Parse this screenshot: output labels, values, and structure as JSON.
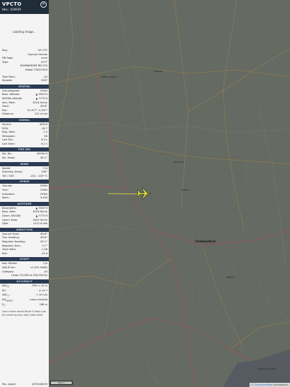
{
  "header": {
    "registration": "VPCTO",
    "hex": "Hex.: 424919",
    "close_icon": "close-icon"
  },
  "image": {
    "loading": "Loading image..."
  },
  "info": [
    {
      "k": "Reg.:",
      "v": "VP-CTO"
    },
    {
      "k": "",
      "v": "Cayman Islands"
    },
    {
      "k": "DB flags:",
      "v": "none"
    },
    {
      "k": "Type:",
      "v": "GL7T"
    },
    {
      "k": "",
      "v": "BOMBARDIER BD-700"
    },
    {
      "k": "",
      "v": "Global 7500/7500"
    }
  ],
  "info2": [
    {
      "k": "Type Desc.:",
      "v": "L2J"
    },
    {
      "k": "Squawk:",
      "v": "5267"
    }
  ],
  "sections": [
    {
      "title": "SPATIAL",
      "rows": [
        {
          "k": "Groundspeed:",
          "v": "293kt"
        },
        {
          "k": "Baro. Altitude:",
          "v": "▲ 7625 ft"
        },
        {
          "k": "WGS84 altitude:",
          "v": "▲ 7775 ft"
        },
        {
          "k": "Vert. Rate:",
          "v": "3024 ft/min"
        },
        {
          "k": "Track:",
          "v": "85.8°"
        },
        {
          "k": "Pos.:",
          "v": "51.917°, 0.337°"
        },
        {
          "k": "Distance:",
          "v": "221.4 nmi"
        }
      ]
    },
    {
      "title": "SIGNAL",
      "rows": [
        {
          "k": "Source:",
          "v": "ADS-B"
        },
        {
          "k": "RSSI:",
          "v": "-18.7"
        },
        {
          "k": "Msg. Rate:",
          "v": "1.5"
        },
        {
          "k": "Messages:",
          "v": "68"
        },
        {
          "k": "Last Pos.:",
          "v": "8.3 s"
        },
        {
          "k": "Last Seen:",
          "v": "8.1 s"
        }
      ]
    },
    {
      "title": "FMS SEL",
      "rows": [
        {
          "k": "Sel. Alt.:",
          "v": "40000 ft"
        },
        {
          "k": "Sel. Head.:",
          "v": "85.1°"
        }
      ]
    },
    {
      "title": "WIND",
      "rows": [
        {
          "k": "Speed:",
          "v": "7 kt"
        },
        {
          "k": "Direction (from):",
          "v": "290°"
        },
        {
          "k": "TAT / OAT:",
          "v": "-101 / -109 °C"
        }
      ]
    },
    {
      "title": "SPEED",
      "rows": [
        {
          "k": "Ground:",
          "v": "293kt"
        },
        {
          "k": "True:",
          "v": "216kt"
        },
        {
          "k": "Indicated:",
          "v": "293kt"
        },
        {
          "k": "Mach:",
          "v": "0.436"
        }
      ]
    },
    {
      "title": "ALTITUDE",
      "rows": [
        {
          "k": "Barometric:",
          "v": "▲ 7625 ft"
        },
        {
          "k": "Baro. Rate:",
          "v": "3024 ft/min"
        },
        {
          "k": "Geom. WGS84:",
          "v": "▲ 7775 ft"
        },
        {
          "k": "Geom. Rate:",
          "v": "2820 ft/min"
        },
        {
          "k": "QNH:",
          "v": "1012.8 hPa"
        }
      ]
    },
    {
      "title": "DIRECTION",
      "rows": [
        {
          "k": "Ground Track:",
          "v": "85.8°"
        },
        {
          "k": "True Heading:",
          "v": "85.8°"
        },
        {
          "k": "Magnetic Heading:",
          "v": "85.1°"
        },
        {
          "k": "Magnetic Decl.:",
          "v": "0.7°"
        },
        {
          "k": "Track Rate:",
          "v": "-1.28"
        },
        {
          "k": "Roll:",
          "v": "-15.6"
        }
      ]
    },
    {
      "title": "STUFF",
      "rows": [
        {
          "k": "Nav. Modes:",
          "v": "n/a"
        },
        {
          "k": "ADS-B Ver.:",
          "v": "v2 (DO-260B)"
        },
        {
          "k": "Category:",
          "v": "A3"
        },
        {
          "k": "",
          "v": "Large (75,000 to 300,000 lb)"
        }
      ]
    },
    {
      "title": "ACCURACY",
      "rows": [
        {
          "k": "NAC<sub>P</sub>:",
          "v": "EPU < 10 m"
        },
        {
          "k": "SIL:",
          "v": "≤ 1e-7"
        },
        {
          "k": "NAC<sub>V</sub>:",
          "v": "< 10 m/s"
        },
        {
          "k": "NIC<sub>BARO</sub>:",
          "v": "cross-checked"
        },
        {
          "k": "R<sub>C</sub>:",
          "v": "186 m"
        }
      ]
    }
  ],
  "note": {
    "text": "Learn more about Mode S data type by hovering over each data label.",
    "link": "label."
  },
  "footer": {
    "pos_epoch": "Pos. epoch:",
    "pos_epoch_value": "1670246476"
  },
  "map": {
    "attribution_prefix": "©",
    "attribution_link": "OpenStreetMap",
    "attribution_suffix": "contributors.",
    "scale": "500 m",
    "places": [
      {
        "name": "Chelmsford",
        "cls": "big"
      },
      {
        "name": "Braintree",
        "cls": ""
      },
      {
        "name": "Witham",
        "cls": ""
      },
      {
        "name": "Halstead",
        "cls": ""
      },
      {
        "name": "Southend-on-Sea",
        "cls": ""
      },
      {
        "name": "Maldon",
        "cls": ""
      },
      {
        "name": "Saffron Walden",
        "cls": ""
      }
    ]
  },
  "aircraft": {
    "icon": "plane-icon",
    "color": "#dcdc3c",
    "track_color": "#e8e84a"
  }
}
